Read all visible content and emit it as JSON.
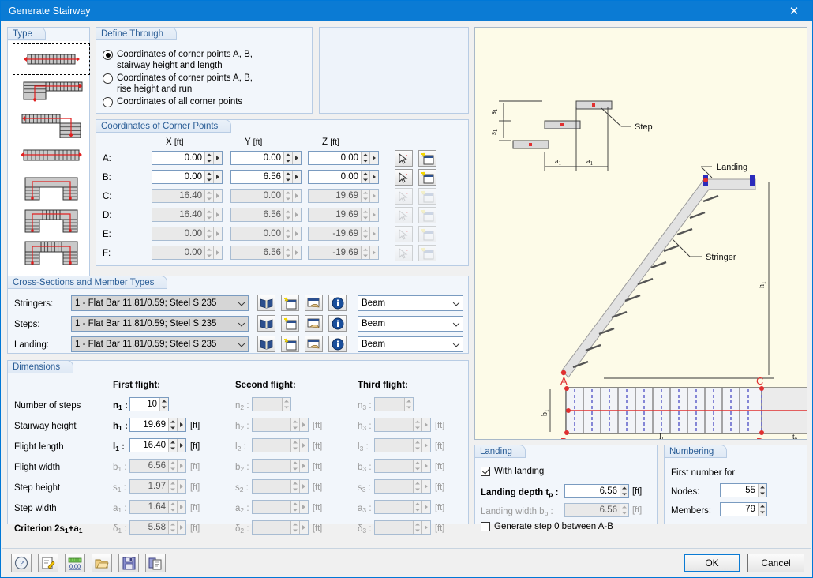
{
  "window": {
    "title": "Generate Stairway",
    "close_icon": "close-icon"
  },
  "type_panel": {
    "title": "Type",
    "thumbs": [
      {
        "name": "straight-flight",
        "selected": true
      },
      {
        "name": "l-shape-right",
        "selected": false
      },
      {
        "name": "l-shape-left",
        "selected": false
      },
      {
        "name": "split-straight",
        "selected": false
      },
      {
        "name": "u-shape-open",
        "selected": false
      },
      {
        "name": "u-shape-mid-flight",
        "selected": false
      },
      {
        "name": "u-shape-full",
        "selected": false
      }
    ]
  },
  "define_through": {
    "title": "Define Through",
    "options": [
      {
        "label_line1": "Coordinates of corner points A, B,",
        "label_line2": "stairway height and length",
        "selected": true
      },
      {
        "label_line1": "Coordinates of corner points A, B,",
        "label_line2": "rise height and run",
        "selected": false
      },
      {
        "label_line1": "Coordinates of all corner points",
        "label_line2": "",
        "selected": false
      }
    ]
  },
  "coordinates": {
    "title": "Coordinates of Corner Points",
    "headers": {
      "x": "X",
      "y": "Y",
      "z": "Z",
      "unit": "[ft]"
    },
    "pick_icon": "pick-point-icon",
    "new_icon": "new-window-icon",
    "rows": [
      {
        "label": "A:",
        "x": "0.00",
        "y": "0.00",
        "z": "0.00",
        "enabled": true
      },
      {
        "label": "B:",
        "x": "0.00",
        "y": "6.56",
        "z": "0.00",
        "enabled": true
      },
      {
        "label": "C:",
        "x": "16.40",
        "y": "0.00",
        "z": "19.69",
        "enabled": false
      },
      {
        "label": "D:",
        "x": "16.40",
        "y": "6.56",
        "z": "19.69",
        "enabled": false
      },
      {
        "label": "E:",
        "x": "0.00",
        "y": "0.00",
        "z": "-19.69",
        "enabled": false
      },
      {
        "label": "F:",
        "x": "0.00",
        "y": "6.56",
        "z": "-19.69",
        "enabled": false
      }
    ]
  },
  "cross_sections": {
    "title": "Cross-Sections and Member Types",
    "icons": [
      "library-icon",
      "new-window-icon",
      "import-icon",
      "info-icon"
    ],
    "rows": [
      {
        "label": "Stringers:",
        "section": "1 - Flat Bar 11.81/0.59; Steel S 235",
        "member_type": "Beam"
      },
      {
        "label": "Steps:",
        "section": "1 - Flat Bar 11.81/0.59; Steel S 235",
        "member_type": "Beam"
      },
      {
        "label": "Landing:",
        "section": "1 - Flat Bar 11.81/0.59; Steel S 235",
        "member_type": "Beam"
      }
    ]
  },
  "dimensions": {
    "title": "Dimensions",
    "col_headers": [
      "First flight:",
      "Second flight:",
      "Third flight:"
    ],
    "unit": "[ft]",
    "rows": [
      {
        "label": "Number of steps",
        "sym": "n",
        "v1": "10",
        "v2": "",
        "v3": "",
        "e1": true,
        "unit": false
      },
      {
        "label": "Stairway height",
        "sym": "h",
        "v1": "19.69",
        "v2": "",
        "v3": "",
        "e1": true,
        "unit": true
      },
      {
        "label": "Flight length",
        "sym": "l",
        "v1": "16.40",
        "v2": "",
        "v3": "",
        "e1": true,
        "unit": true
      },
      {
        "label": "Flight width",
        "sym": "b",
        "v1": "6.56",
        "v2": "",
        "v3": "",
        "e1": false,
        "unit": true
      },
      {
        "label": "Step height",
        "sym": "s",
        "v1": "1.97",
        "v2": "",
        "v3": "",
        "e1": false,
        "unit": true
      },
      {
        "label": "Step width",
        "sym": "a",
        "v1": "1.64",
        "v2": "",
        "v3": "",
        "e1": false,
        "unit": true
      },
      {
        "label": "Criterion 2s",
        "sym": "δ",
        "v1": "5.58",
        "v2": "",
        "v3": "",
        "e1": false,
        "unit": true,
        "label_suffix": "+a"
      }
    ]
  },
  "landing": {
    "title": "Landing",
    "with_landing": {
      "label": "With landing",
      "checked": true
    },
    "depth": {
      "label": "Landing depth t",
      "sub": "p",
      "value": "6.56",
      "unit": "[ft]",
      "enabled": true
    },
    "width": {
      "label": "Landing width b",
      "sub": "p",
      "value": "6.56",
      "unit": "[ft]",
      "enabled": false
    },
    "generate_step": {
      "label": "Generate step 0 between A-B",
      "checked": false
    }
  },
  "numbering": {
    "title": "Numbering",
    "subtitle": "First number for",
    "nodes": {
      "label": "Nodes:",
      "value": "55"
    },
    "members": {
      "label": "Members:",
      "value": "79"
    }
  },
  "preview": {
    "bg": "#fdfbe8",
    "labels": {
      "step": "Step",
      "landing": "Landing",
      "stringer": "Stringer",
      "s1": "s",
      "a1": "a",
      "h1": "h",
      "b1": "b",
      "l1": "l",
      "tp": "t",
      "ptA": "A",
      "ptB": "B",
      "ptC": "C",
      "ptD": "D"
    }
  },
  "toolbar": {
    "buttons": [
      {
        "name": "help-button",
        "icon": "help-icon"
      },
      {
        "name": "edit-button",
        "icon": "edit-icon"
      },
      {
        "name": "units-button",
        "icon": "units-icon"
      },
      {
        "name": "open-button",
        "icon": "folder-open-icon"
      },
      {
        "name": "save-button",
        "icon": "save-icon"
      },
      {
        "name": "copy-button",
        "icon": "copy-icon"
      }
    ]
  },
  "footer": {
    "ok": "OK",
    "cancel": "Cancel"
  }
}
